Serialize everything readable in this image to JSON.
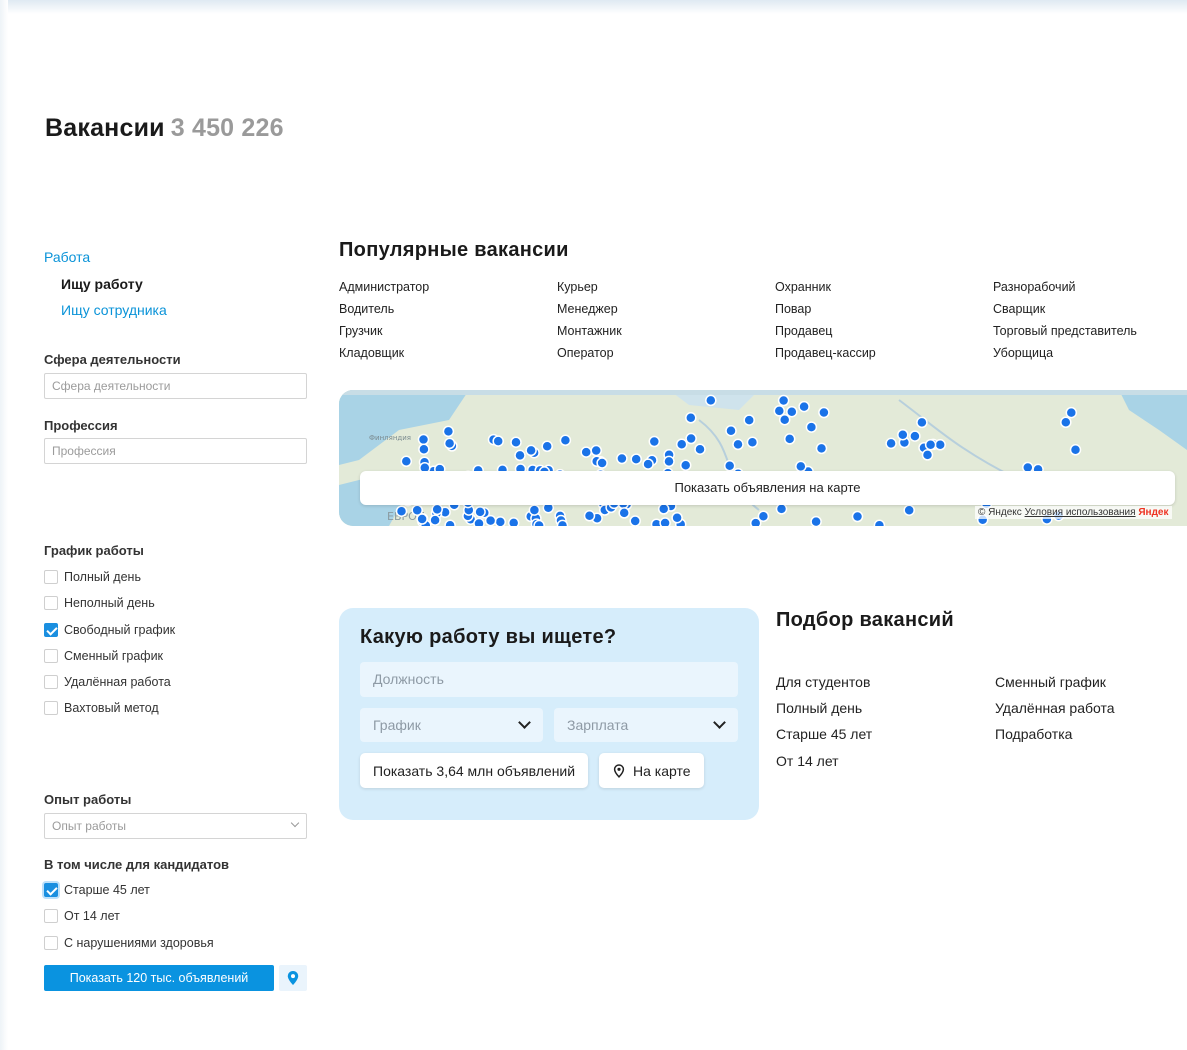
{
  "header": {
    "title": "Вакансии",
    "count": "3 450 226"
  },
  "sidebar": {
    "category_title": "Работа",
    "category_items": [
      "Ищу работу",
      "Ищу сотрудника"
    ],
    "sphere_label": "Сфера деятельности",
    "sphere_placeholder": "Сфера деятельности",
    "profession_label": "Профессия",
    "profession_placeholder": "Профессия",
    "schedule_label": "График работы",
    "schedule_options": [
      {
        "label": "Полный день",
        "checked": false
      },
      {
        "label": "Неполный день",
        "checked": false
      },
      {
        "label": "Свободный график",
        "checked": true
      },
      {
        "label": "Сменный график",
        "checked": false
      },
      {
        "label": "Удалённая работа",
        "checked": false
      },
      {
        "label": "Вахтовый метод",
        "checked": false
      }
    ],
    "experience_label": "Опыт работы",
    "experience_value": "Опыт работы",
    "candidates_label": "В том числе для кандидатов",
    "candidate_options": [
      {
        "label": "Старше 45 лет",
        "checked": true
      },
      {
        "label": "От 14 лет",
        "checked": false
      },
      {
        "label": "С нарушениями здоровья",
        "checked": false
      }
    ],
    "show_button": "Показать 120 тыс. объявлений",
    "map_pin_icon": "map-pin-icon"
  },
  "popular": {
    "title": "Популярные вакансии",
    "items": [
      "Администратор",
      "Курьер",
      "Охранник",
      "Разнорабочий",
      "Водитель",
      "Менеджер",
      "Повар",
      "Сварщик",
      "Грузчик",
      "Монтажник",
      "Продавец",
      "Торговый представитель",
      "Кладовщик",
      "Оператор",
      "Продавец-кассир",
      "Уборщица"
    ]
  },
  "map": {
    "show_button": "Показать объявления на карте",
    "copyright": "© Яндекс",
    "terms": "Условия использования",
    "brand": "Яндек",
    "labels": [
      "Финляндия",
      "ЕВРОП"
    ],
    "marker_color": "#1a73e8"
  },
  "search_card": {
    "title": "Какую работу вы ищете?",
    "position_placeholder": "Должность",
    "schedule_select": "График",
    "salary_select": "Зарплата",
    "show_button": "Показать 3,64 млн объявлений",
    "map_button": "На карте"
  },
  "selection": {
    "title": "Подбор вакансий",
    "col1": [
      "Для студентов",
      "Полный день",
      "Старше 45 лет",
      "От 14 лет"
    ],
    "col2": [
      "Сменный график",
      "Удалённая работа",
      "Подработка"
    ]
  }
}
